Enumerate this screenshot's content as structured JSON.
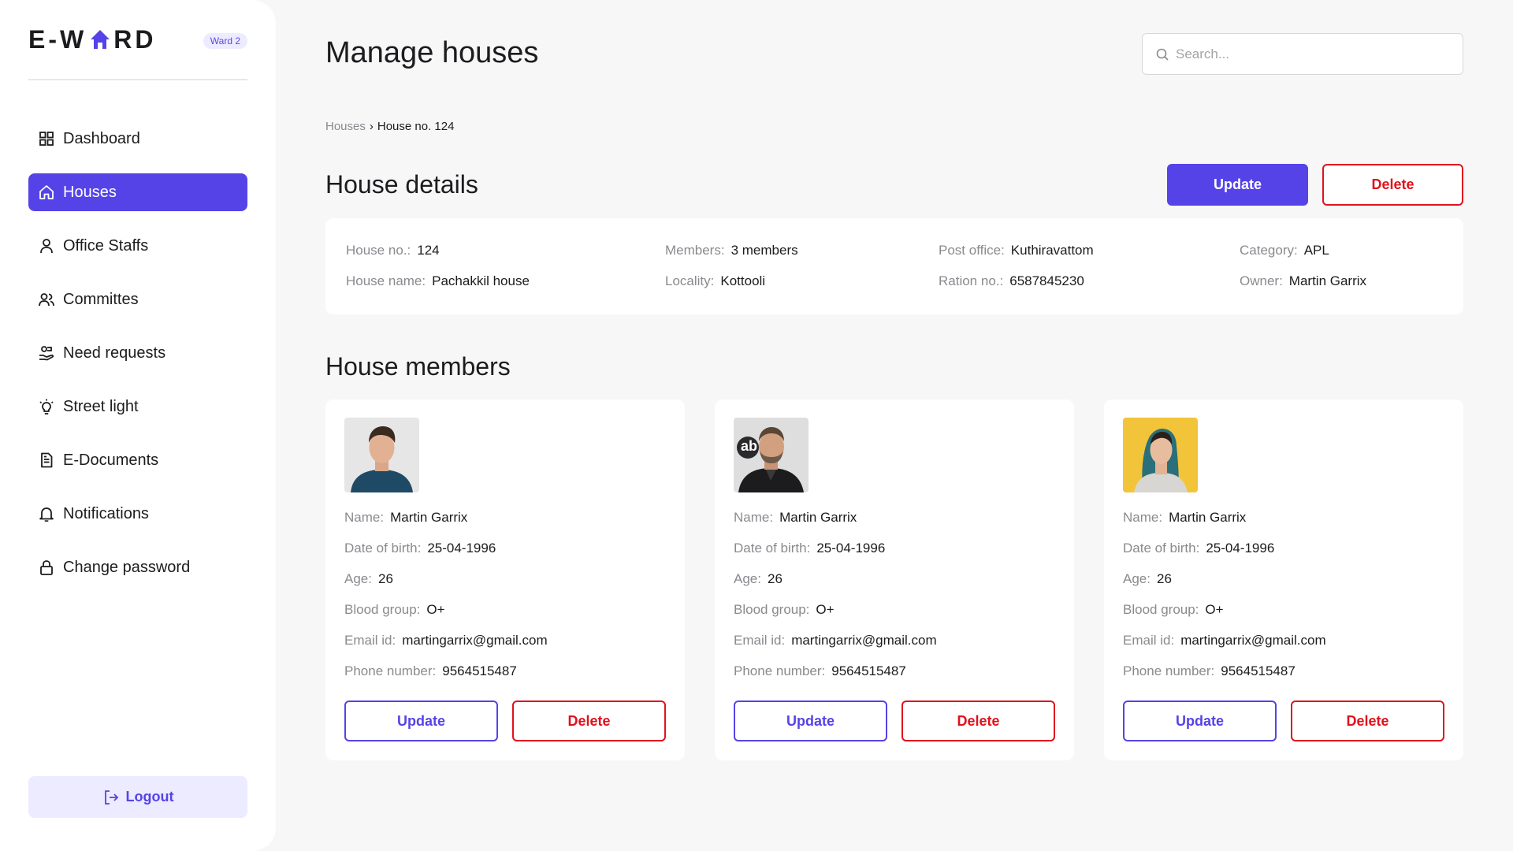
{
  "brand": {
    "logo_text_1": "E-W",
    "logo_text_2": "RD",
    "ward_badge": "Ward 2"
  },
  "sidebar": {
    "items": [
      {
        "label": "Dashboard",
        "icon": "grid-icon"
      },
      {
        "label": "Houses",
        "icon": "home-icon",
        "active": true
      },
      {
        "label": "Office Staffs",
        "icon": "user-icon"
      },
      {
        "label": "Committes",
        "icon": "users-icon"
      },
      {
        "label": "Need requests",
        "icon": "hand-icon"
      },
      {
        "label": "Street light",
        "icon": "bulb-icon"
      },
      {
        "label": "E-Documents",
        "icon": "document-icon"
      },
      {
        "label": "Notifications",
        "icon": "bell-icon"
      },
      {
        "label": "Change password",
        "icon": "lock-icon"
      }
    ],
    "logout_label": "Logout"
  },
  "header": {
    "title": "Manage houses",
    "search_placeholder": "Search..."
  },
  "breadcrumb": {
    "parent": "Houses",
    "separator": "›",
    "current": "House no. 124"
  },
  "house_details": {
    "title": "House details",
    "update_label": "Update",
    "delete_label": "Delete",
    "fields": {
      "house_no": {
        "label": "House no.:",
        "value": "124"
      },
      "house_name": {
        "label": "House name:",
        "value": "Pachakkil house"
      },
      "members": {
        "label": "Members:",
        "value": "3 members"
      },
      "locality": {
        "label": "Locality:",
        "value": "Kottooli"
      },
      "post_office": {
        "label": "Post office:",
        "value": "Kuthiravattom"
      },
      "ration_no": {
        "label": "Ration no.:",
        "value": "6587845230"
      },
      "category": {
        "label": "Category:",
        "value": "APL"
      },
      "owner": {
        "label": "Owner:",
        "value": "Martin Garrix"
      }
    }
  },
  "house_members": {
    "title": "House members",
    "labels": {
      "name": "Name:",
      "dob": "Date of birth:",
      "age": "Age:",
      "blood": "Blood group:",
      "email": "Email id:",
      "phone": "Phone number:"
    },
    "update_label": "Update",
    "delete_label": "Delete",
    "members": [
      {
        "name": "Martin Garrix",
        "dob": "25-04-1996",
        "age": "26",
        "blood": "O+",
        "email": "martingarrix@gmail.com",
        "phone": "9564515487",
        "photo_bg": "#e6e6e6"
      },
      {
        "name": "Martin Garrix",
        "dob": "25-04-1996",
        "age": "26",
        "blood": "O+",
        "email": "martingarrix@gmail.com",
        "phone": "9564515487",
        "photo_bg": "#dedede",
        "photo_text": "ab"
      },
      {
        "name": "Martin Garrix",
        "dob": "25-04-1996",
        "age": "26",
        "blood": "O+",
        "email": "martingarrix@gmail.com",
        "phone": "9564515487",
        "photo_bg": "#f2c43a"
      }
    ]
  },
  "colors": {
    "accent": "#5543e8",
    "danger": "#e0121c",
    "badge_bg": "#ecebff",
    "page_bg": "#f7f7f8"
  }
}
